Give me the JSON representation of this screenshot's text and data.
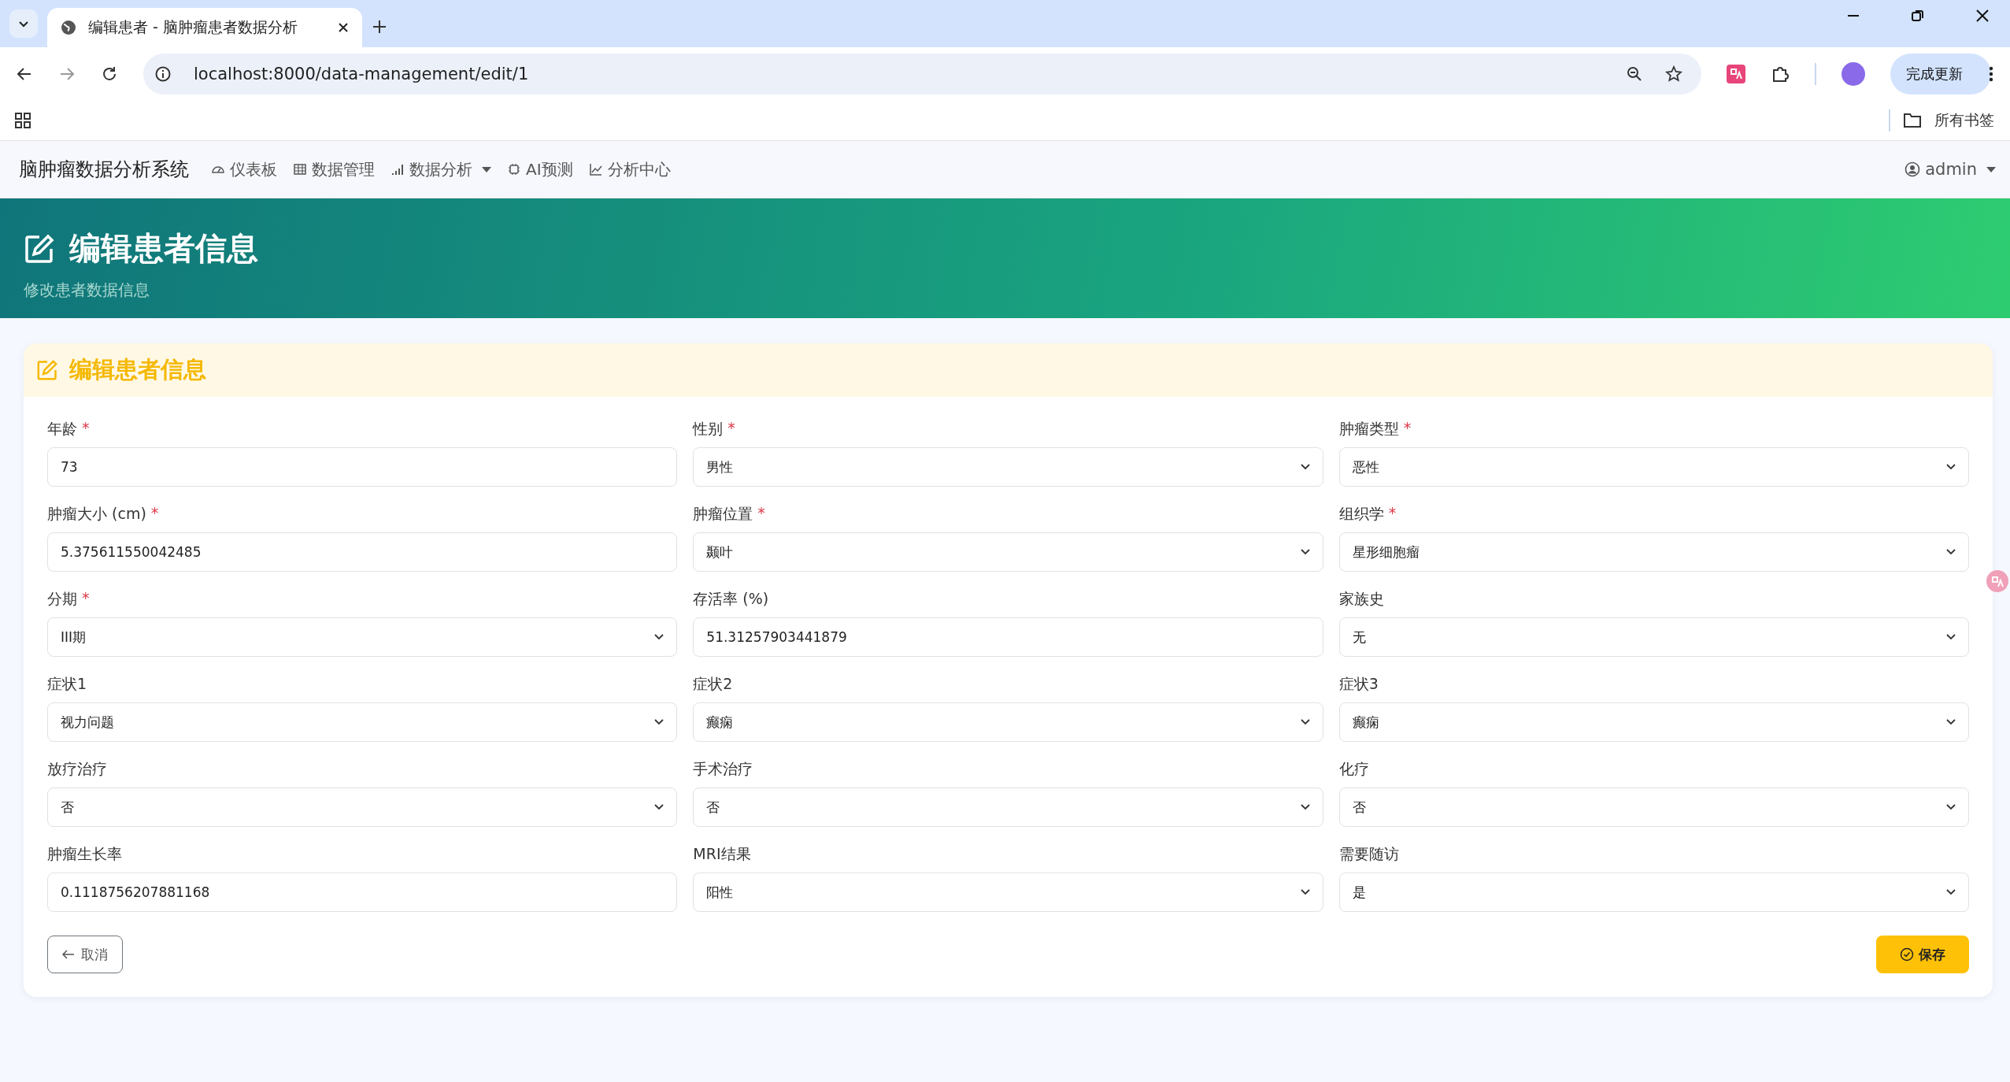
{
  "browser": {
    "tab": {
      "title": "编辑患者 - 脑肿瘤患者数据分析",
      "selected": true
    },
    "url": "localhost:8000/data-management/edit/1",
    "update_button": "完成更新",
    "bookmarks": "所有书签"
  },
  "navbar": {
    "brand": "脑肿瘤数据分析系统",
    "items": [
      {
        "label": "仪表板",
        "dropdown": false
      },
      {
        "label": "数据管理",
        "dropdown": false
      },
      {
        "label": "数据分析",
        "dropdown": true
      },
      {
        "label": "AI预测",
        "dropdown": false
      },
      {
        "label": "分析中心",
        "dropdown": false
      }
    ],
    "user": "admin"
  },
  "banner": {
    "title": "编辑患者信息",
    "subtitle": "修改患者数据信息"
  },
  "card": {
    "title": "编辑患者信息",
    "fields": [
      {
        "kind": "input",
        "label": "年龄",
        "required_mark": "*",
        "value": "73"
      },
      {
        "kind": "select",
        "label": "性别",
        "required_mark": "*",
        "value": "男性"
      },
      {
        "kind": "select",
        "label": "肿瘤类型",
        "required_mark": "*",
        "value": "恶性"
      },
      {
        "kind": "input",
        "label": "肿瘤大小 (cm)",
        "required_mark": "*",
        "value": "5.375611550042485"
      },
      {
        "kind": "select",
        "label": "肿瘤位置",
        "required_mark": "*",
        "value": "颞叶"
      },
      {
        "kind": "select",
        "label": "组织学",
        "required_mark": "*",
        "value": "星形细胞瘤"
      },
      {
        "kind": "select",
        "label": "分期",
        "required_mark": "*",
        "value": "III期"
      },
      {
        "kind": "input",
        "label": "存活率 (%)",
        "value": "51.31257903441879"
      },
      {
        "kind": "select",
        "label": "家族史",
        "value": "无"
      },
      {
        "kind": "select",
        "label": "症状1",
        "value": "视力问题"
      },
      {
        "kind": "select",
        "label": "症状2",
        "value": "癫痫"
      },
      {
        "kind": "select",
        "label": "症状3",
        "value": "癫痫"
      },
      {
        "kind": "select",
        "label": "放疗治疗",
        "value": "否"
      },
      {
        "kind": "select",
        "label": "手术治疗",
        "value": "否"
      },
      {
        "kind": "select",
        "label": "化疗",
        "value": "否"
      },
      {
        "kind": "input",
        "label": "肿瘤生长率",
        "value": "0.1118756207881168"
      },
      {
        "kind": "select",
        "label": "MRI结果",
        "value": "阳性"
      },
      {
        "kind": "select",
        "label": "需要随访",
        "value": "是"
      }
    ],
    "cancel": "取消",
    "save": "保存"
  }
}
